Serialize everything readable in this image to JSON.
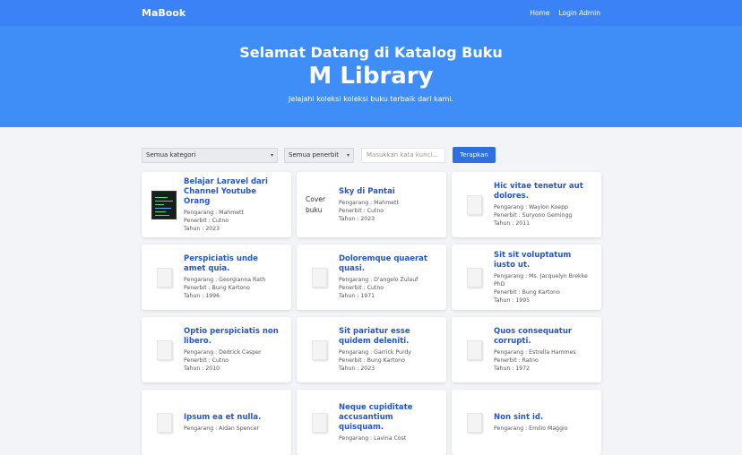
{
  "nav": {
    "brand": "MaBook",
    "home": "Home",
    "login": "Login Admin"
  },
  "hero": {
    "title": "Selamat Datang di Katalog Buku",
    "main": "M Library",
    "subtitle": "Jelajahi koleksi koleksi buku terbaik dari kami."
  },
  "filters": {
    "kategori": "Semua kategori",
    "penerbit": "Semua penerbit",
    "search_placeholder": "Masukkan kata kunci...",
    "apply": "Terapkan"
  },
  "cover_text": "Cover buku",
  "books": [
    {
      "title": "Belajar Laravel dari Channel Youtube Orang",
      "author": "Pengarang : Mahmett",
      "publisher": "Penerbit : Cutno",
      "year": "Tahun : 2023"
    },
    {
      "title": "Sky di Pantai",
      "author": "Pengarang : Mahmett",
      "publisher": "Penerbit : Cutno",
      "year": "Tahun : 2023"
    },
    {
      "title": "Hic vitae tenetur aut dolores.",
      "author": "Pengarang : Waylon Koepp",
      "publisher": "Penerbit : Suryono Gemingg",
      "year": "Tahun : 2011"
    },
    {
      "title": "Perspiciatis unde amet quia.",
      "author": "Pengarang : Georgianna Rath",
      "publisher": "Penerbit : Bung Kartono",
      "year": "Tahun : 1996"
    },
    {
      "title": "Doloremque quaerat quasi.",
      "author": "Pengarang : D'angelo Zulauf",
      "publisher": "Penerbit : Cutno",
      "year": "Tahun : 1971"
    },
    {
      "title": "Sit sit voluptatum iusto ut.",
      "author": "Pengarang : Ms. Jacquelyn Brekke PhD",
      "publisher": "Penerbit : Bung Kartono",
      "year": "Tahun : 1995"
    },
    {
      "title": "Optio perspiciatis non libero.",
      "author": "Pengarang : Dedrick Casper",
      "publisher": "Penerbit : Cutno",
      "year": "Tahun : 2010"
    },
    {
      "title": "Sit pariatur esse quidem deleniti.",
      "author": "Pengarang : Garrick Purdy",
      "publisher": "Penerbit : Bung Kartono",
      "year": "Tahun : 2023"
    },
    {
      "title": "Quos consequatur corrupti.",
      "author": "Pengarang : Estrella Hammes",
      "publisher": "Penerbit : Ratno",
      "year": "Tahun : 1972"
    },
    {
      "title": "Ipsum ea et nulla.",
      "author": "Pengarang : Aidan Spencer",
      "publisher": "",
      "year": ""
    },
    {
      "title": "Neque cupiditate accusantium quisquam.",
      "author": "Pengarang : Lavina Cost",
      "publisher": "",
      "year": ""
    },
    {
      "title": "Non sint id.",
      "author": "Pengarang : Emilio Maggio",
      "publisher": "",
      "year": ""
    }
  ]
}
